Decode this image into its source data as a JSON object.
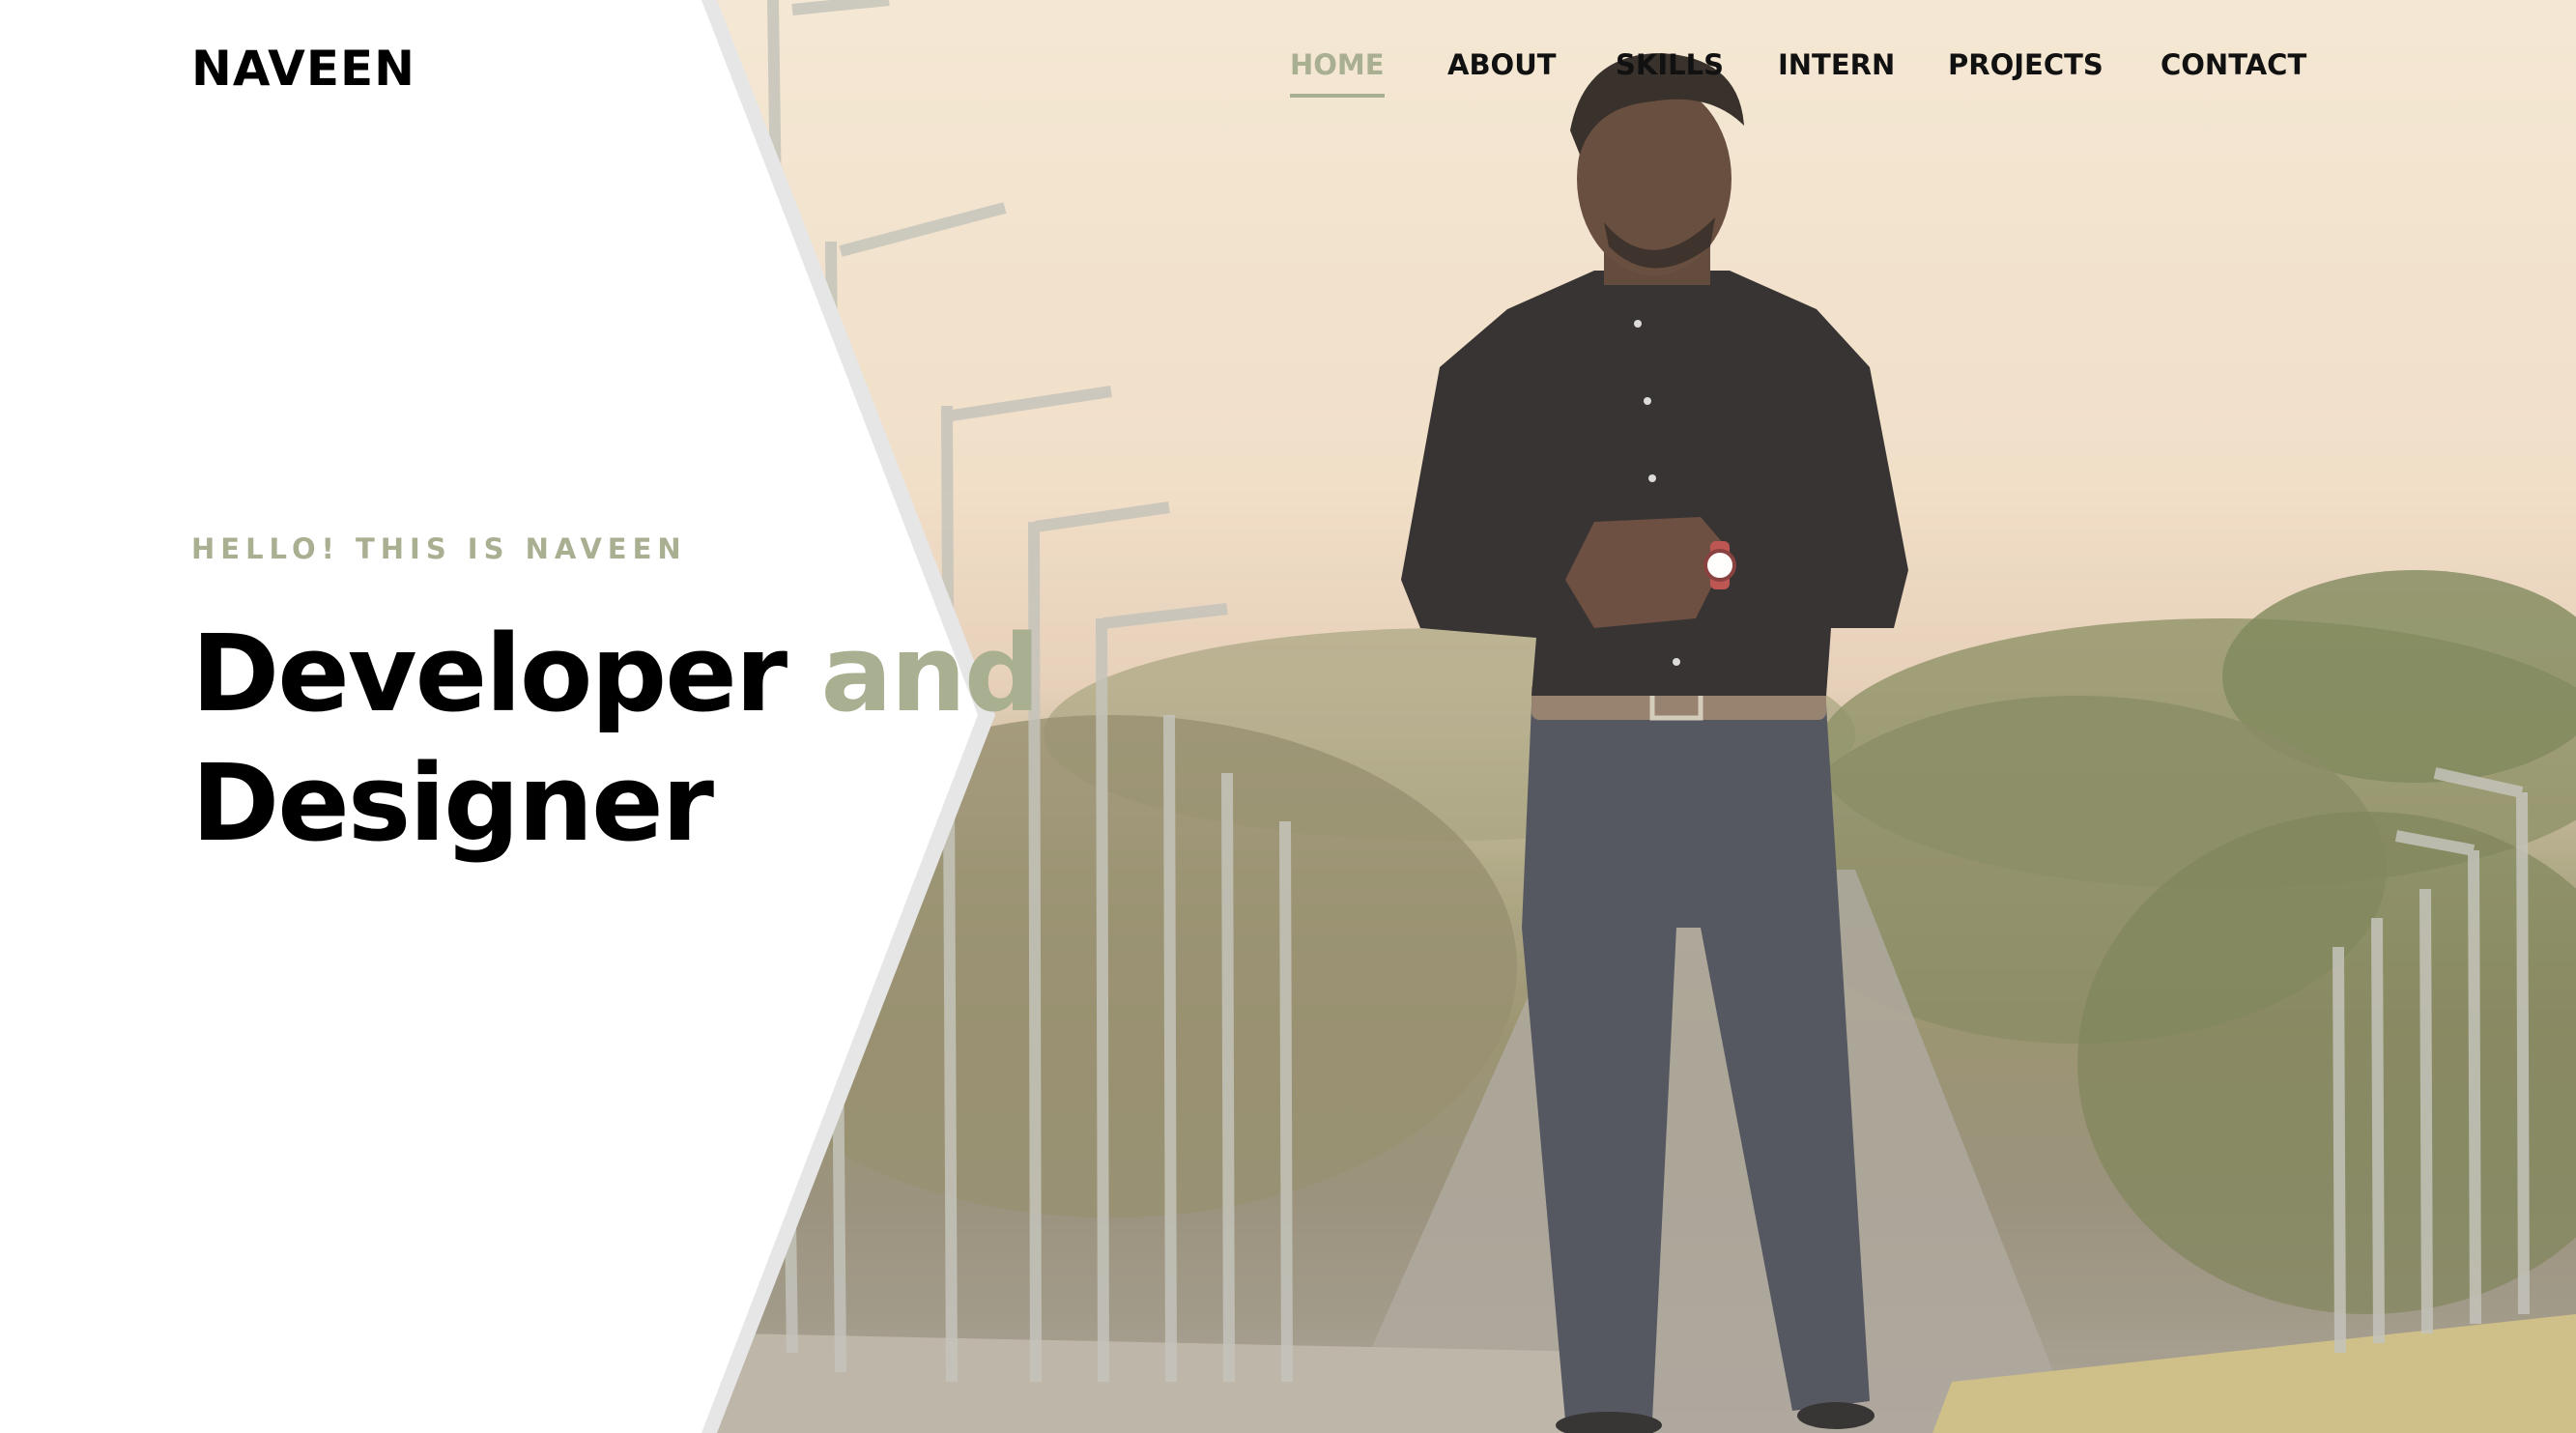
{
  "brand": {
    "name": "NAVEEN"
  },
  "nav": {
    "items": [
      {
        "label": "HOME",
        "active": true
      },
      {
        "label": "ABOUT",
        "active": false
      },
      {
        "label": "SKILLS",
        "active": false
      },
      {
        "label": "INTERN",
        "active": false
      },
      {
        "label": "PROJECTS",
        "active": false
      },
      {
        "label": "CONTACT",
        "active": false
      }
    ]
  },
  "hero": {
    "subtitle": "HELLO! THIS IS NAVEEN",
    "title_word1": "Developer",
    "title_accent": "and",
    "title_line2": "Designer"
  },
  "colors": {
    "accent": "#a9af91",
    "text": "#000000",
    "panel": "#ffffff",
    "panel_edge": "#e6e6e6"
  }
}
